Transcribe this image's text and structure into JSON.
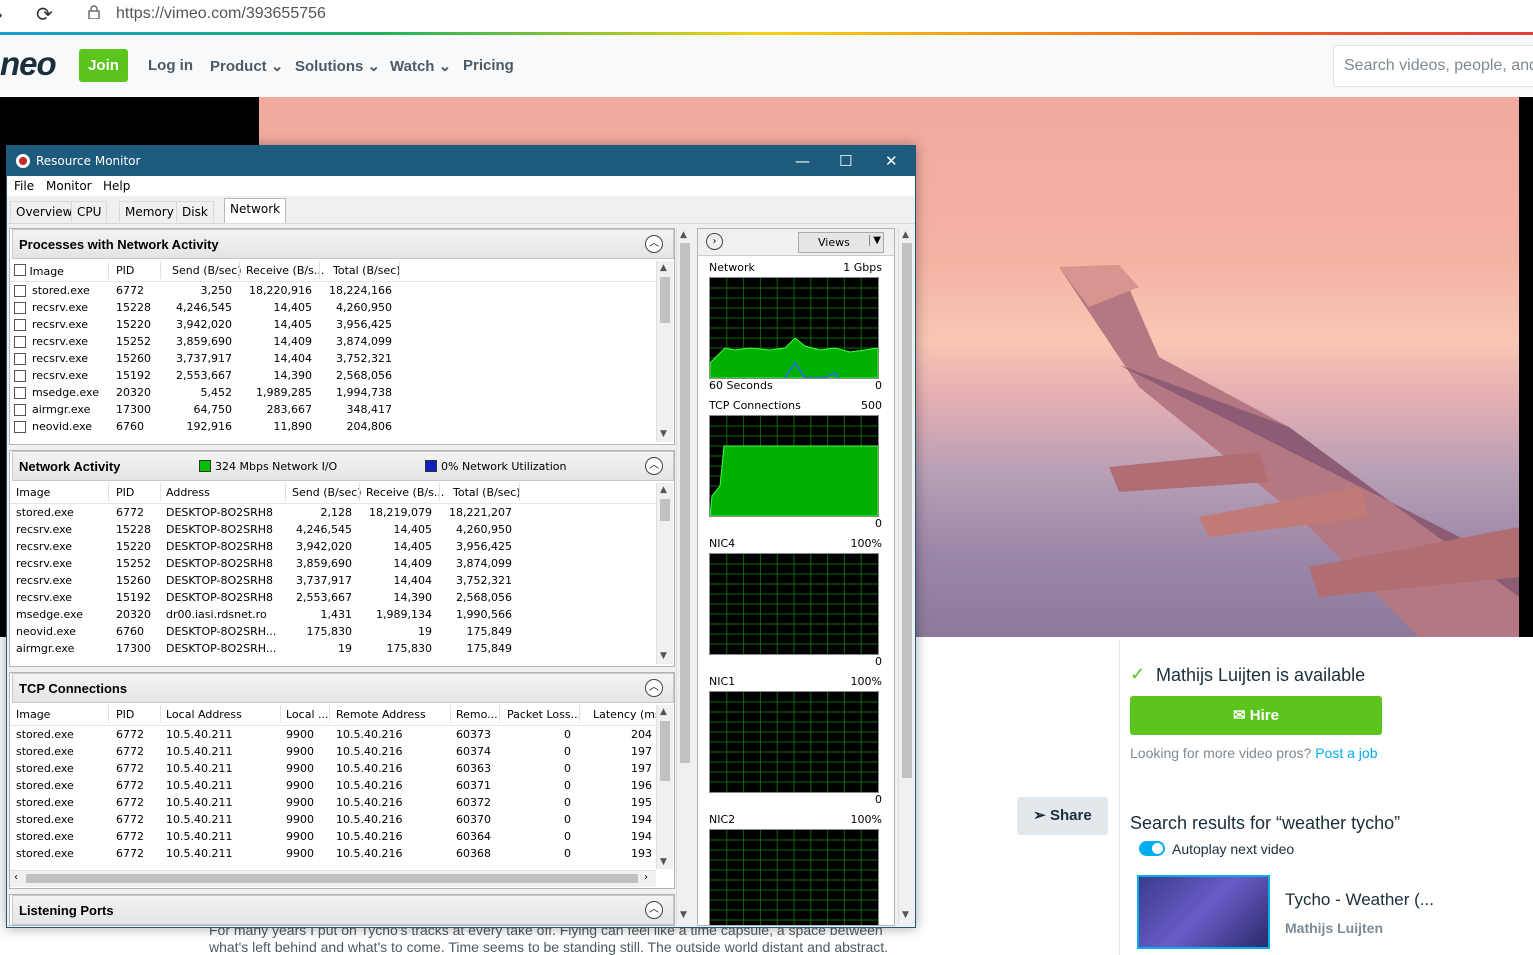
{
  "browser": {
    "url": "https://vimeo.com/393655756"
  },
  "vimeo": {
    "logo": "neo",
    "join": "Join",
    "nav": [
      "Log in",
      "Product",
      "Solutions",
      "Watch",
      "Pricing"
    ],
    "search_placeholder": "Search videos, people, and more",
    "available": "Mathijs Luijten is available",
    "hire": "Hire",
    "looking": "Looking for more video pros?",
    "post_job": "Post a job",
    "share": "Share",
    "search_results": "Search results for “weather tycho”",
    "autoplay": "Autoplay next video",
    "thumb_title": "Tycho - Weather (...",
    "thumb_author": "Mathijs Luijten",
    "desc_1": "For many years I put on Tycho's tracks at every take off. Flying can feel like a time capsule, a space between",
    "desc_2": "what's left behind and what's to come. Time seems to be standing still. The outside world distant and abstract."
  },
  "rm": {
    "title": "Resource Monitor",
    "menu": [
      "File",
      "Monitor",
      "Help"
    ],
    "tabs": [
      "Overview",
      "CPU",
      "Memory",
      "Disk",
      "Network"
    ],
    "proc": {
      "title": "Processes with Network Activity",
      "headers": [
        "Image",
        "PID",
        "Send (B/sec)",
        "Receive (B/s...",
        "Total (B/sec)"
      ],
      "rows": [
        [
          "stored.exe",
          "6772",
          "3,250",
          "18,220,916",
          "18,224,166"
        ],
        [
          "recsrv.exe",
          "15228",
          "4,246,545",
          "14,405",
          "4,260,950"
        ],
        [
          "recsrv.exe",
          "15220",
          "3,942,020",
          "14,405",
          "3,956,425"
        ],
        [
          "recsrv.exe",
          "15252",
          "3,859,690",
          "14,409",
          "3,874,099"
        ],
        [
          "recsrv.exe",
          "15260",
          "3,737,917",
          "14,404",
          "3,752,321"
        ],
        [
          "recsrv.exe",
          "15192",
          "2,553,667",
          "14,390",
          "2,568,056"
        ],
        [
          "msedge.exe",
          "20320",
          "5,452",
          "1,989,285",
          "1,994,738"
        ],
        [
          "airmgr.exe",
          "17300",
          "64,750",
          "283,667",
          "348,417"
        ],
        [
          "neovid.exe",
          "6760",
          "192,916",
          "11,890",
          "204,806"
        ]
      ]
    },
    "net": {
      "title": "Network Activity",
      "io": "324 Mbps Network I/O",
      "util": "0% Network Utilization",
      "headers": [
        "Image",
        "PID",
        "Address",
        "Send (B/sec)",
        "Receive (B/s...",
        "Total (B/sec)"
      ],
      "rows": [
        [
          "stored.exe",
          "6772",
          "DESKTOP-8O2SRH8",
          "2,128",
          "18,219,079",
          "18,221,207"
        ],
        [
          "recsrv.exe",
          "15228",
          "DESKTOP-8O2SRH8",
          "4,246,545",
          "14,405",
          "4,260,950"
        ],
        [
          "recsrv.exe",
          "15220",
          "DESKTOP-8O2SRH8",
          "3,942,020",
          "14,405",
          "3,956,425"
        ],
        [
          "recsrv.exe",
          "15252",
          "DESKTOP-8O2SRH8",
          "3,859,690",
          "14,409",
          "3,874,099"
        ],
        [
          "recsrv.exe",
          "15260",
          "DESKTOP-8O2SRH8",
          "3,737,917",
          "14,404",
          "3,752,321"
        ],
        [
          "recsrv.exe",
          "15192",
          "DESKTOP-8O2SRH8",
          "2,553,667",
          "14,390",
          "2,568,056"
        ],
        [
          "msedge.exe",
          "20320",
          "dr00.iasi.rdsnet.ro",
          "1,431",
          "1,989,134",
          "1,990,566"
        ],
        [
          "neovid.exe",
          "6760",
          "DESKTOP-8O2SRH...",
          "175,830",
          "19",
          "175,849"
        ],
        [
          "airmgr.exe",
          "17300",
          "DESKTOP-8O2SRH...",
          "19",
          "175,830",
          "175,849"
        ]
      ]
    },
    "tcp": {
      "title": "TCP Connections",
      "headers": [
        "Image",
        "PID",
        "Local Address",
        "Local ...",
        "Remote Address",
        "Remo...",
        "Packet Loss...",
        "Latency (ms)"
      ],
      "rows": [
        [
          "stored.exe",
          "6772",
          "10.5.40.211",
          "9900",
          "10.5.40.216",
          "60373",
          "0",
          "204"
        ],
        [
          "stored.exe",
          "6772",
          "10.5.40.211",
          "9900",
          "10.5.40.216",
          "60374",
          "0",
          "197"
        ],
        [
          "stored.exe",
          "6772",
          "10.5.40.211",
          "9900",
          "10.5.40.216",
          "60363",
          "0",
          "197"
        ],
        [
          "stored.exe",
          "6772",
          "10.5.40.211",
          "9900",
          "10.5.40.216",
          "60371",
          "0",
          "196"
        ],
        [
          "stored.exe",
          "6772",
          "10.5.40.211",
          "9900",
          "10.5.40.216",
          "60372",
          "0",
          "195"
        ],
        [
          "stored.exe",
          "6772",
          "10.5.40.211",
          "9900",
          "10.5.40.216",
          "60370",
          "0",
          "194"
        ],
        [
          "stored.exe",
          "6772",
          "10.5.40.211",
          "9900",
          "10.5.40.216",
          "60364",
          "0",
          "194"
        ],
        [
          "stored.exe",
          "6772",
          "10.5.40.211",
          "9900",
          "10.5.40.216",
          "60368",
          "0",
          "193"
        ]
      ]
    },
    "listen": {
      "title": "Listening Ports"
    },
    "views": "Views",
    "graphs": [
      {
        "name": "Network",
        "max": "1 Gbps",
        "footer_left": "60 Seconds",
        "footer_right": "0"
      },
      {
        "name": "TCP Connections",
        "max": "500",
        "footer_right": "0"
      },
      {
        "name": "NIC4",
        "max": "100%",
        "footer_right": "0"
      },
      {
        "name": "NIC1",
        "max": "100%",
        "footer_right": "0"
      },
      {
        "name": "NIC2",
        "max": "100%"
      }
    ]
  }
}
